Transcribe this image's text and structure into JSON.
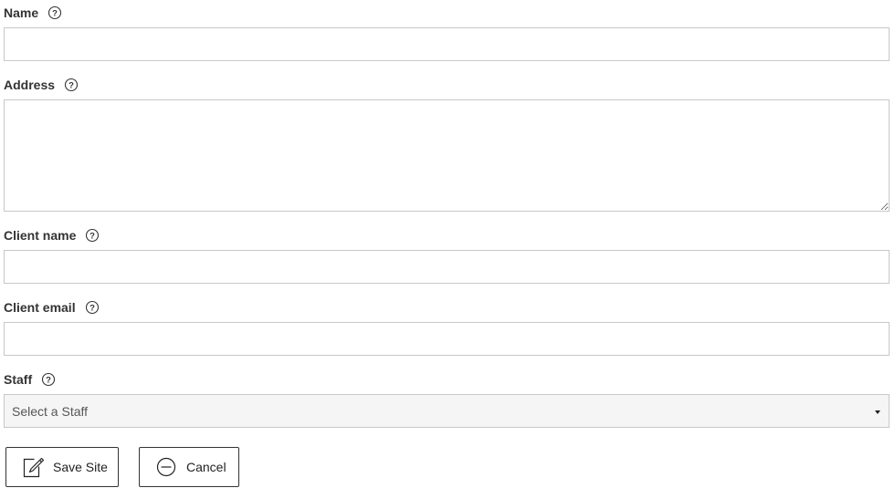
{
  "form": {
    "name": {
      "label": "Name",
      "value": "",
      "placeholder": ""
    },
    "address": {
      "label": "Address",
      "value": "",
      "placeholder": ""
    },
    "client_name": {
      "label": "Client name",
      "value": "",
      "placeholder": ""
    },
    "client_email": {
      "label": "Client email",
      "value": "",
      "placeholder": ""
    },
    "staff": {
      "label": "Staff",
      "selected": "Select a Staff"
    },
    "help_icon": "question-circle-icon"
  },
  "actions": {
    "save": {
      "label": "Save Site",
      "icon": "edit-icon"
    },
    "cancel": {
      "label": "Cancel",
      "icon": "minus-circle-icon"
    }
  }
}
